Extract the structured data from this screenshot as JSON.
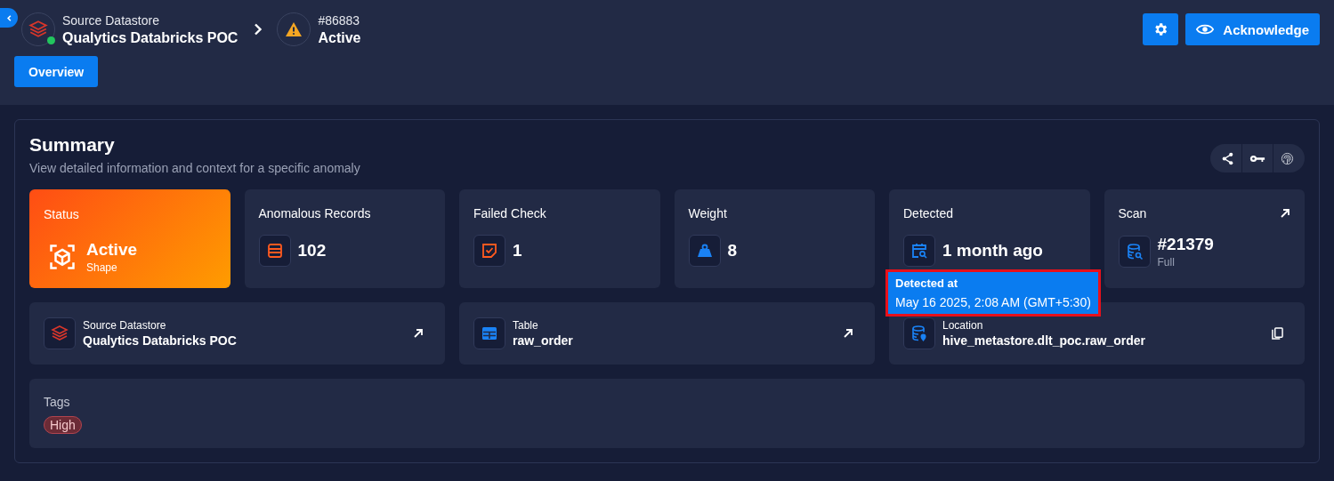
{
  "header": {
    "datastore": {
      "label": "Source Datastore",
      "name": "Qualytics Databricks POC",
      "online": true
    },
    "anomaly": {
      "id": "#86883",
      "status": "Active"
    },
    "acknowledge": {
      "label": "Acknowledge"
    }
  },
  "tabs": [
    {
      "label": "Overview",
      "selected": true
    }
  ],
  "summary": {
    "title": "Summary",
    "subtitle": "View detailed information and context for a specific anomaly",
    "stats": [
      {
        "kind": "status",
        "label": "Status",
        "value": "Active",
        "sub": "Shape"
      },
      {
        "kind": "records",
        "label": "Anomalous Records",
        "value": "102"
      },
      {
        "kind": "check",
        "label": "Failed Check",
        "value": "1"
      },
      {
        "kind": "weight",
        "label": "Weight",
        "value": "8"
      },
      {
        "kind": "detected",
        "label": "Detected",
        "value": "1 month ago",
        "tooltip": {
          "title": "Detected at",
          "text": "May 16 2025, 2:08 AM (GMT+5:30)"
        }
      },
      {
        "kind": "scan",
        "label": "Scan",
        "value": "#21379",
        "sub": "Full",
        "link": true
      }
    ],
    "details": [
      {
        "kind": "datastore",
        "label": "Source Datastore",
        "value": "Qualytics Databricks POC",
        "link": true
      },
      {
        "kind": "table",
        "label": "Table",
        "value": "raw_order",
        "link": true
      },
      {
        "kind": "location",
        "label": "Location",
        "value": "hive_metastore.dlt_poc.raw_order",
        "copyable": true
      }
    ],
    "tags": {
      "label": "Tags",
      "items": [
        {
          "label": "High"
        }
      ]
    }
  }
}
